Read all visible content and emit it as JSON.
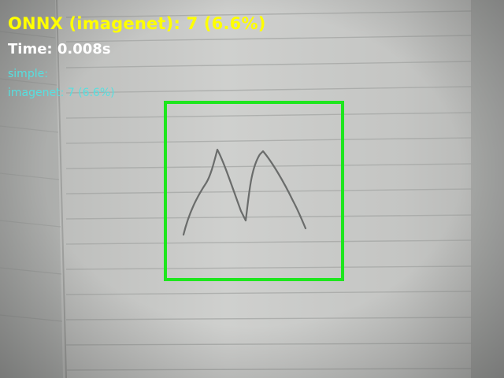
{
  "overlay": {
    "prediction_line": "ONNX (imagenet): 7 (6.6%)",
    "time_line": "Time: 0.008s",
    "model_results": [
      "simple: ",
      "imagenet: 7 (6.6%)"
    ]
  },
  "colors": {
    "prediction_text": "#ffff00",
    "time_text": "#ffffff",
    "results_text": "#55e0e0",
    "detection_box": "#1ee61e"
  }
}
